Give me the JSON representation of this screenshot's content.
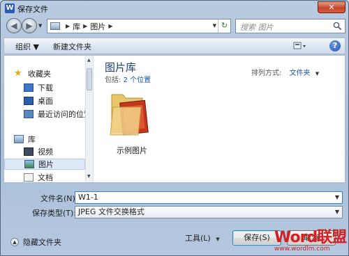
{
  "window": {
    "title": "保存文件",
    "app_icon_letter": "W",
    "close_symbol": "✕"
  },
  "navbar": {
    "breadcrumbs": [
      "库",
      "图片"
    ],
    "search_placeholder": "搜索 图片"
  },
  "toolbar": {
    "organize": "组织 ▼",
    "new_folder": "新建文件夹",
    "help": "?"
  },
  "sidebar": {
    "favorites": "收藏夹",
    "downloads": "下载",
    "desktop": "桌面",
    "recent": "最近访问的位置",
    "libraries": "库",
    "videos": "视频",
    "pictures": "图片",
    "documents": "文档"
  },
  "main": {
    "library_title": "图片库",
    "includes_label": "包括:",
    "includes_link": "2 个位置",
    "arrange_label": "排列方式:",
    "arrange_value": "文件夹",
    "folder_name": "示例图片"
  },
  "form": {
    "filename_label": "文件名(N):",
    "filename_value": "W1-1",
    "filetype_label": "保存类型(T):",
    "filetype_value": "JPEG 文件交换格式"
  },
  "footer": {
    "hide_folders": "隐藏文件夹",
    "tools": "工具(L)",
    "save": "保存(S)",
    "cancel": "取消"
  },
  "watermark": {
    "logo": "Word联盟",
    "url": "www.wordlm.com"
  },
  "colors": {
    "link": "#1a54a8",
    "library_title": "#1e3b73",
    "selection": "#dde9f7"
  }
}
